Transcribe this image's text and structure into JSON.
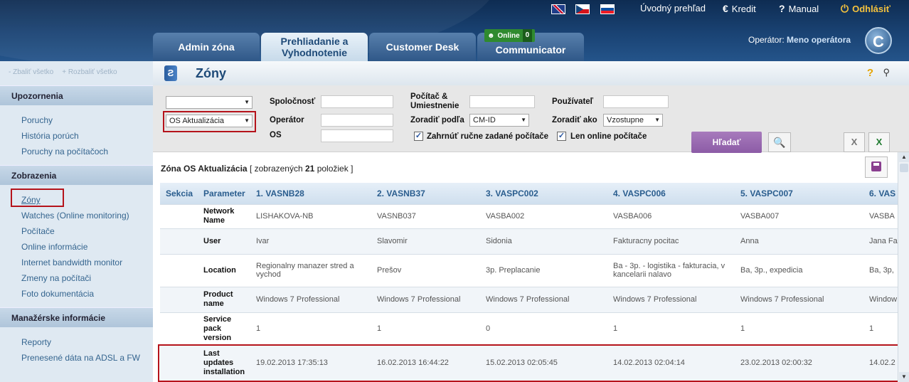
{
  "top_links": {
    "home": "Úvodný prehľad",
    "credit": "Kredit",
    "manual": "Manual",
    "logout": "Odhlásiť"
  },
  "icons": {
    "credit": "euro-icon",
    "manual": "question-icon",
    "logout": "power-icon"
  },
  "tabs": [
    {
      "label": "Admin zóna"
    },
    {
      "label": "Prehliadanie a Vyhodnotenie"
    },
    {
      "label": "Customer Desk"
    },
    {
      "label": "Communicator"
    }
  ],
  "online": {
    "label": "Online",
    "count": "0"
  },
  "operator": {
    "label": "Operátor:",
    "name": "Meno operátora"
  },
  "sidebar": {
    "collapse_all": "- Zbaliť všetko",
    "expand_all": "+ Rozbaliť všetko",
    "sections": [
      {
        "title": "Upozornenia",
        "items": [
          "Poruchy",
          "História porúch",
          "Poruchy na počítačoch"
        ]
      },
      {
        "title": "Zobrazenia",
        "items": [
          "Zóny",
          "Watches (Online monitoring)",
          "Počítače",
          "Online informácie",
          "Internet bandwidth monitor",
          "Zmeny na počítači",
          "Foto dokumentácia"
        ]
      },
      {
        "title": "Manažérske informácie",
        "items": [
          "Reporty",
          "Prenesené dáta na ADSL a FW"
        ]
      }
    ]
  },
  "page": {
    "title": "Zóny"
  },
  "filters": {
    "top_select": "",
    "zone_select": "OS Aktualizácia",
    "company_label": "Spoločnosť",
    "operator_label": "Operátor",
    "os_label": "OS",
    "computer_label": "Počítač & Umiestnenie",
    "sort_by_label": "Zoradiť podľa",
    "sort_by_value": "CM-ID",
    "user_label": "Používateľ",
    "sort_as_label": "Zoradiť ako",
    "sort_as_value": "Vzostupne",
    "include_manual": "Zahrnúť ručne zadané počítače",
    "only_online": "Len online počítače",
    "search_button": "Hľadať"
  },
  "summary": {
    "prefix": "Zóna OS Aktualizácia",
    "open": "[ zobrazených",
    "count": "21",
    "close": "položiek ]"
  },
  "table": {
    "headers": [
      "Sekcia",
      "Parameter",
      "1. VASNB28",
      "2. VASNB37",
      "3. VASPC002",
      "4. VASPC006",
      "5. VASPC007",
      "6. VAS"
    ],
    "rows": [
      {
        "param": "Network Name",
        "values": [
          "LISHAKOVA-NB",
          "VASNB037",
          "VASBA002",
          "VASBA006",
          "VASBA007",
          "VASBA"
        ]
      },
      {
        "param": "User",
        "values": [
          "Ivar",
          "Slavomir",
          "Sidonia",
          "Fakturacny pocitac",
          "Anna",
          "Jana Fa"
        ]
      },
      {
        "param": "Location",
        "values": [
          "Regionalny manazer stred a vychod",
          "Prešov",
          "3p. Preplacanie",
          "Ba - 3p. - logistika - fakturacia, v kancelarii nalavo",
          "Ba, 3p., expedicia",
          "Ba, 3p,"
        ]
      },
      {
        "param": "Product name",
        "values": [
          "Windows 7 Professional",
          "Windows 7 Professional",
          "Windows 7 Professional",
          "Windows 7 Professional",
          "Windows 7 Professional",
          "Window"
        ]
      },
      {
        "param": "Service pack version",
        "values": [
          "1",
          "1",
          "0",
          "1",
          "1",
          "1"
        ]
      },
      {
        "param": "Last updates installation",
        "values": [
          "19.02.2013 17:35:13",
          "16.02.2013 16:44:22",
          "15.02.2013 02:05:45",
          "14.02.2013 02:04:14",
          "23.02.2013 02:00:32",
          "14.02.2"
        ]
      }
    ]
  }
}
